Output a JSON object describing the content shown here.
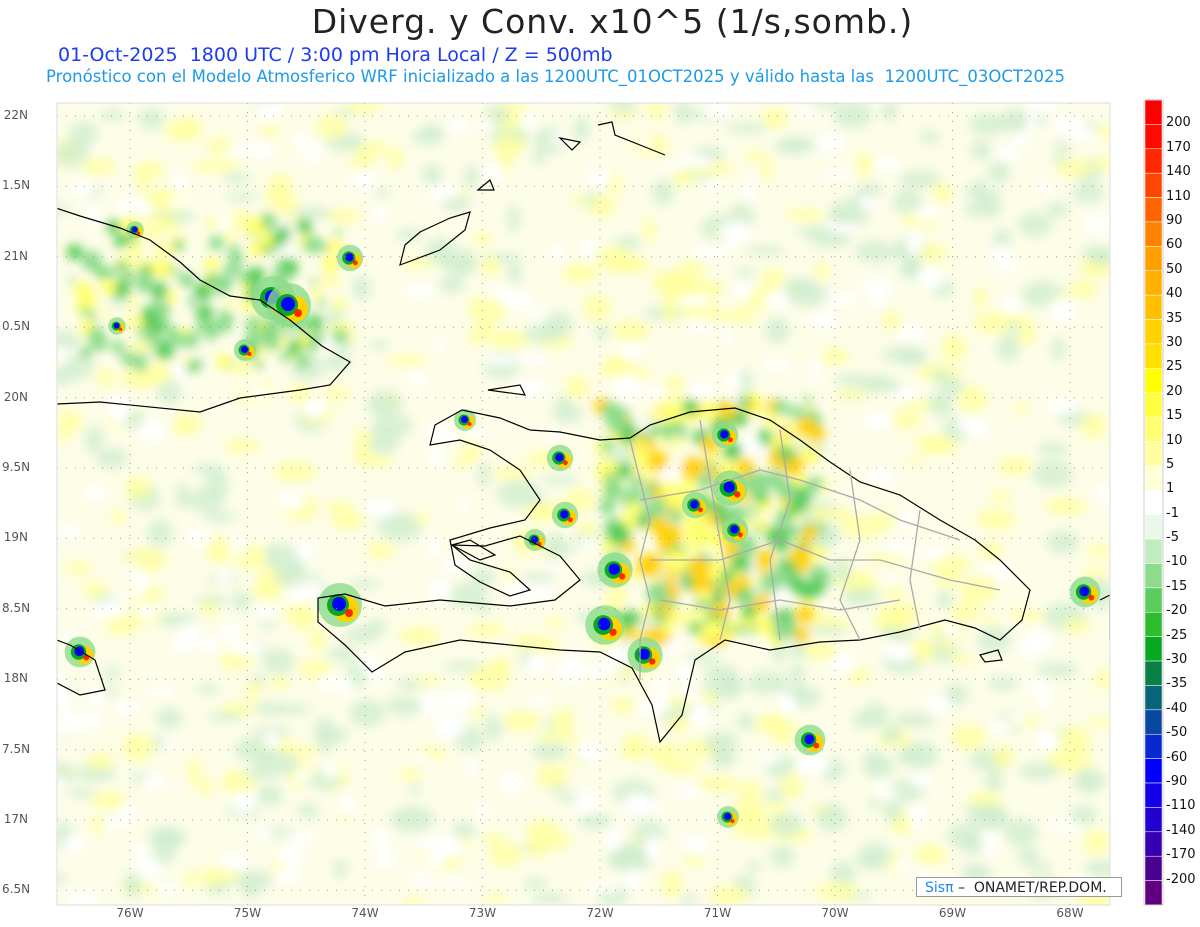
{
  "header": {
    "title": "Diverg. y Conv. x10^5 (1/s,somb.)",
    "subtitle_time": "01-Oct-2025  1800 UTC / 3:00 pm Hora Local / Z = 500mb",
    "subtitle_model": "Pronóstico con el Modelo Atmosferico WRF inicializado a las 1200UTC_01OCT2025 y válido hasta las  1200UTC_03OCT2025"
  },
  "axes": {
    "lat_labels": [
      "22N",
      "1.5N",
      "21N",
      "0.5N",
      "20N",
      "9.5N",
      "19N",
      "8.5N",
      "18N",
      "7.5N",
      "17N",
      "6.5N"
    ],
    "lat_values": [
      22,
      21.5,
      21,
      20.5,
      20,
      19.5,
      19,
      18.5,
      18,
      17.5,
      17,
      16.5
    ],
    "lon_labels": [
      "76W",
      "75W",
      "74W",
      "73W",
      "72W",
      "71W",
      "70W",
      "69W",
      "68W"
    ],
    "lon_values": [
      -76,
      -75,
      -74,
      -73,
      -72,
      -71,
      -70,
      -69,
      -68
    ]
  },
  "colorbar": {
    "labels": [
      "200",
      "170",
      "140",
      "110",
      "90",
      "60",
      "50",
      "40",
      "35",
      "30",
      "25",
      "20",
      "15",
      "10",
      "5",
      "1",
      "-1",
      "-5",
      "-10",
      "-15",
      "-20",
      "-25",
      "-30",
      "-35",
      "-40",
      "-50",
      "-60",
      "-90",
      "-110",
      "-140",
      "-170",
      "-200"
    ],
    "colors": [
      "#ff0000",
      "#ff0a00",
      "#ff2800",
      "#ff4600",
      "#ff6400",
      "#ff8200",
      "#ffa000",
      "#ffb000",
      "#ffc000",
      "#ffd200",
      "#ffe000",
      "#ffff00",
      "#ffff40",
      "#ffff70",
      "#ffffa0",
      "#ffffd8",
      "#ffffff",
      "#eaf8ea",
      "#c0ecc0",
      "#8cdc8c",
      "#5ccc5c",
      "#2cbc2c",
      "#08a820",
      "#088048",
      "#086478",
      "#0848a0",
      "#0828d0",
      "#0000ff",
      "#1400e8",
      "#2400d0",
      "#3400b0",
      "#4a0090",
      "#600080"
    ]
  },
  "credit": {
    "brand": "Sisπ",
    "text": " –  ONAMET/REP.DOM."
  }
}
